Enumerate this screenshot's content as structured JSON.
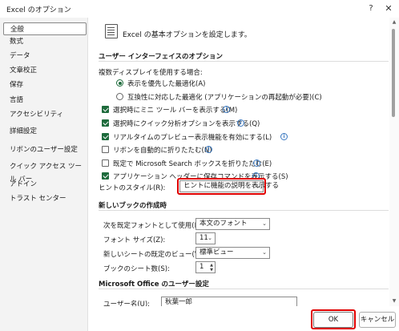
{
  "window": {
    "title": "Excel のオプション",
    "help_icon": "?",
    "close_icon": "✕"
  },
  "sidebar": {
    "items": [
      {
        "label": "全般",
        "active": true
      },
      {
        "label": "数式"
      },
      {
        "label": "データ"
      },
      {
        "label": "文章校正"
      },
      {
        "label": "保存"
      },
      {
        "label": "言語"
      },
      {
        "label": "アクセシビリティ"
      },
      {
        "label": "詳細設定"
      },
      {
        "label": "リボンのユーザー設定"
      },
      {
        "label": "クイック アクセス ツール バー"
      },
      {
        "label": "アドイン"
      },
      {
        "label": "トラスト センター"
      }
    ]
  },
  "main": {
    "header": "Excel の基本オプションを設定します。",
    "ui_section": {
      "title": "ユーザー インターフェイスのオプション",
      "multi_display_label": "複数ディスプレイを使用する場合:",
      "radio_optimize_display": {
        "label": "表示を優先した最適化(A)",
        "checked": true
      },
      "radio_optimize_compat": {
        "label": "互換性に対応した最適化 (アプリケーションの再起動が必要)(C)",
        "checked": false
      },
      "cb_minitoolbar": {
        "label": "選択時にミニ ツール バーを表示する(M)",
        "checked": true
      },
      "cb_quickanalysis": {
        "label": "選択時にクイック分析オプションを表示する(Q)",
        "checked": true
      },
      "cb_livepreview": {
        "label": "リアルタイムのプレビュー表示機能を有効にする(L)",
        "checked": true
      },
      "cb_collapse_ribbon": {
        "label": "リボンを自動的に折りたたむ(N)",
        "checked": false
      },
      "cb_collapse_search": {
        "label": "既定で Microsoft Search ボックスを折りたたむ(E)",
        "checked": false
      },
      "cb_save_commands": {
        "label": "アプリケーション ヘッダーに保存コマンドを表示する(S)",
        "checked": true
      },
      "tooltip_style_label": "ヒントのスタイル(R):",
      "tooltip_style_value": "ヒントに機能の説明を表示する"
    },
    "new_workbook_section": {
      "title": "新しいブックの作成時",
      "font_label": "次を既定フォントとして使用(N):",
      "font_value": "本文のフォント",
      "font_size_label": "フォント サイズ(Z):",
      "font_size_value": "11",
      "default_view_label": "新しいシートの既定のビュー(V):",
      "default_view_value": "標準ビュー",
      "sheet_count_label": "ブックのシート数(S):",
      "sheet_count_value": "1"
    },
    "office_section": {
      "title": "Microsoft Office のユーザー設定",
      "username_label": "ユーザー名(U):",
      "username_value": "秋葉一郎"
    }
  },
  "footer": {
    "ok_label": "OK",
    "cancel_label": "キャンセル"
  },
  "colors": {
    "accent": "#1e6b3c",
    "highlight": "#e00000"
  }
}
